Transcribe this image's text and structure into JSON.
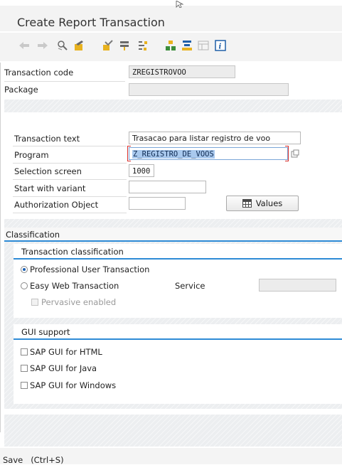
{
  "window": {
    "title": "Create Report Transaction"
  },
  "toolbar": {
    "icons": [
      "back-arrow-icon",
      "forward-arrow-icon",
      "other-object-icon",
      "display-change-icon",
      "check-icon",
      "activate-icon",
      "where-used-icon",
      "object-list-icon",
      "navigation-window-icon",
      "layout-icon",
      "info-icon"
    ]
  },
  "form": {
    "transaction_code": {
      "label": "Transaction code",
      "value": "ZREGISTROVOO"
    },
    "package": {
      "label": "Package",
      "value": ""
    },
    "transaction_text": {
      "label": "Transaction text",
      "value": "Trasacao para listar registro de voo"
    },
    "program": {
      "label": "Program",
      "value": "Z_REGISTRO_DE_VOOS"
    },
    "selection_screen": {
      "label": "Selection screen",
      "value": "1000"
    },
    "start_with_variant": {
      "label": "Start with variant",
      "value": ""
    },
    "authorization_object": {
      "label": "Authorization Object",
      "value": ""
    },
    "values_button": "Values"
  },
  "classification": {
    "title": "Classification",
    "transaction_classification": {
      "title": "Transaction classification",
      "professional": "Professional User Transaction",
      "easy_web": "Easy Web Transaction",
      "service_label": "Service",
      "service_value": "",
      "pervasive": "Pervasive enabled",
      "selected": "professional"
    },
    "gui_support": {
      "title": "GUI support",
      "html": "SAP GUI for HTML",
      "java": "SAP GUI for Java",
      "windows": "SAP GUI for Windows"
    }
  },
  "status_bar": {
    "text": "Save   (Ctrl+S)"
  },
  "colors": {
    "accent_line": "#2e8bd6",
    "selection_highlight": "#a9c9ee",
    "required_marker": "#d9302c"
  }
}
